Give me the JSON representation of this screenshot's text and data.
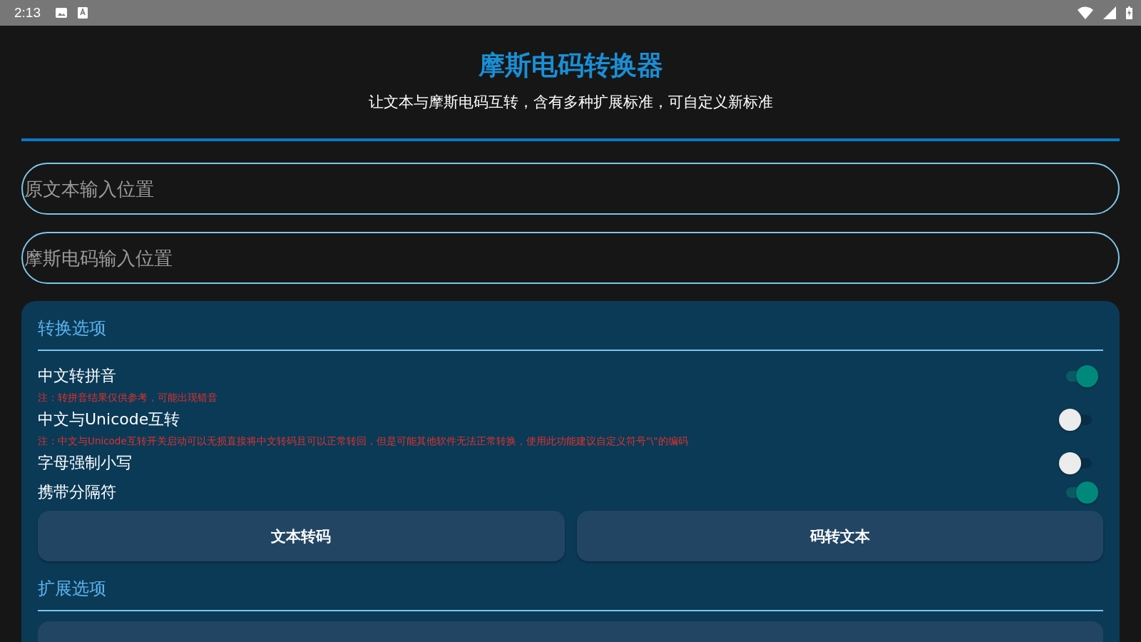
{
  "status_bar": {
    "time": "2:13"
  },
  "header": {
    "title": "摩斯电码转换器",
    "subtitle": "让文本与摩斯电码互转，含有多种扩展标准，可自定义新标准"
  },
  "fields": [
    {
      "placeholder": "原文本输入位置"
    },
    {
      "placeholder": "摩斯电码输入位置"
    }
  ],
  "conversion_options": {
    "heading": "转换选项",
    "options": [
      {
        "label": "中文转拼音",
        "on": true,
        "note": "注：转拼音结果仅供参考，可能出现错音"
      },
      {
        "label": "中文与Unicode互转",
        "on": false,
        "note": "注：中文与Unicode互转开关启动可以无损直接将中文转码且可以正常转回，但是可能其他软件无法正常转换，使用此功能建议自定义符号\"\\\"的编码"
      },
      {
        "label": "字母强制小写",
        "on": false
      },
      {
        "label": "携带分隔符",
        "on": true
      }
    ],
    "buttons": [
      "文本转码",
      "码转文本"
    ]
  },
  "extension_options": {
    "heading": "扩展选项"
  }
}
